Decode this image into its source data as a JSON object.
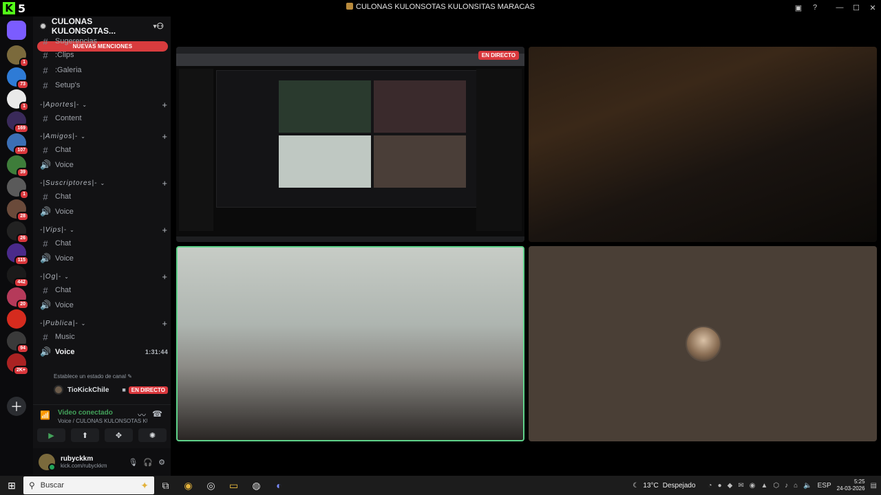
{
  "window": {
    "title": "CULONAS KULONSOTAS KULONSITAS MARACAS",
    "kick_count": "5"
  },
  "rail": {
    "servers": [
      {
        "name": "server-rubyc",
        "badge": "1",
        "color": "#7b6a3c"
      },
      {
        "name": "server-blue",
        "badge": "73",
        "color": "#2e7bd6"
      },
      {
        "name": "server-white",
        "badge": "1",
        "color": "#e9e9e9"
      },
      {
        "name": "server-dark",
        "badge": "169",
        "color": "#3a2a5a"
      },
      {
        "name": "server-blue2",
        "badge": "107",
        "color": "#3b6fb5"
      },
      {
        "name": "server-green",
        "badge": "39",
        "color": "#3e7d3a"
      },
      {
        "name": "server-gray",
        "badge": "1",
        "color": "#5a5a5a"
      },
      {
        "name": "server-char",
        "badge": "28",
        "color": "#6a4a3a"
      },
      {
        "name": "server-tca",
        "badge": "26",
        "color": "#222222"
      },
      {
        "name": "server-purple",
        "badge": "115",
        "color": "#4a2a8a"
      },
      {
        "name": "server-yaper",
        "badge": "442",
        "color": "#1a1a1a"
      },
      {
        "name": "server-pink",
        "badge": "20",
        "color": "#b53a5a"
      },
      {
        "name": "server-chile",
        "badge": "",
        "color": "#d52b1e"
      },
      {
        "name": "server-group",
        "badge": "94",
        "color": "#3a3a3a"
      },
      {
        "name": "server-red",
        "badge": "2K+",
        "color": "#aa2222"
      }
    ]
  },
  "sidebar": {
    "server_name": "CULONAS KULONSOTAS...",
    "mentions_banner": "NUEVAS MENCIONES",
    "top_channels": [
      {
        "label": "Sugerencias",
        "sym": "#"
      },
      {
        "label": ":Clips",
        "sym": "#"
      },
      {
        "label": ":Galeria",
        "sym": "#"
      },
      {
        "label": "Setup's",
        "sym": "#"
      }
    ],
    "categories": [
      {
        "label": "-|Aportes|-",
        "channels": [
          {
            "label": "Content",
            "sym": "#"
          }
        ]
      },
      {
        "label": "-|Amigos|-",
        "channels": [
          {
            "label": "Chat",
            "sym": "#"
          },
          {
            "label": "Voice",
            "sym": "🔊"
          }
        ]
      },
      {
        "label": "-|Suscriptores|-",
        "channels": [
          {
            "label": "Chat",
            "sym": "#"
          },
          {
            "label": "Voice",
            "sym": "🔊"
          }
        ]
      },
      {
        "label": "-|Vips|-",
        "channels": [
          {
            "label": "Chat",
            "sym": "#"
          },
          {
            "label": "Voice",
            "sym": "🔊"
          }
        ]
      },
      {
        "label": "-|Og|-",
        "channels": [
          {
            "label": "Chat",
            "sym": "#"
          },
          {
            "label": "Voice",
            "sym": "🔊"
          }
        ]
      },
      {
        "label": "-|Publica|-",
        "channels": [
          {
            "label": "Music",
            "sym": "#"
          },
          {
            "label": "Voice",
            "sym": "🔊"
          }
        ]
      }
    ],
    "voice_timer": "1:31:44",
    "channel_status": "Establece un estado de canal",
    "voice_member": "TioKickChile",
    "live_label": "EN DIRECTO"
  },
  "voice_panel": {
    "title": "Video conectado",
    "subtitle": "Voice / CULONAS KULONSOTAS KU..."
  },
  "user_panel": {
    "name": "rubyckkm",
    "status": "kick.com/rubyckkm"
  },
  "stage": {
    "live_label": "EN DIRECTO"
  },
  "taskbar": {
    "search_placeholder": "Buscar",
    "temperature": "13°C",
    "weather": "Despejado",
    "language": "ESP",
    "time": "5:25",
    "date": "24-03-2026"
  },
  "colors": {
    "accent_green": "#53fc18",
    "live_red": "#da373c",
    "speaking_green": "#5fd38a"
  }
}
